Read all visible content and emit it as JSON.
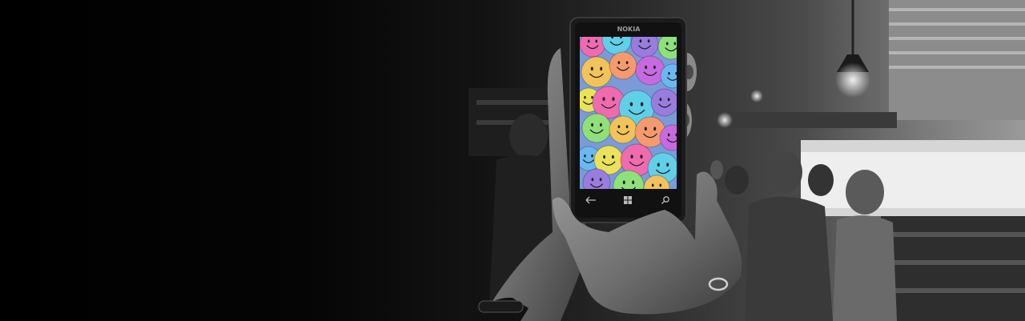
{
  "phone": {
    "brand_text": "NOKIA",
    "nav_icons": [
      "back-arrow-icon",
      "windows-logo-icon",
      "search-icon"
    ]
  },
  "colors": {
    "background_dark": "#000000",
    "background_light": "#9a9a9a",
    "phone_body": "#1b1b1b",
    "smiley_palette": [
      "#f06ab0",
      "#5fd0e8",
      "#9a7be0",
      "#8fe07a",
      "#f2c35a",
      "#f59a6e",
      "#c86adf",
      "#6ab8f2",
      "#e9e25a"
    ]
  }
}
